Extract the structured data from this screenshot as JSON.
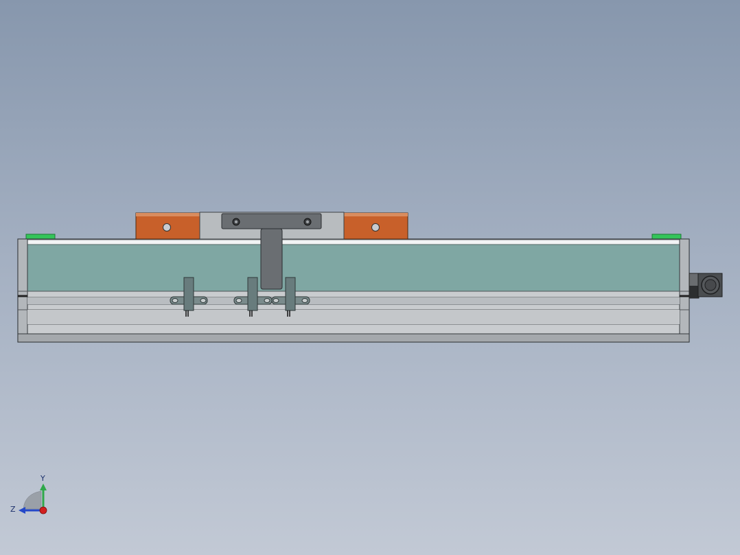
{
  "viewport": {
    "background_top": "#8797ad",
    "background_bottom": "#c2c9d5"
  },
  "model": {
    "colors": {
      "housing_aluminum": "#c9cccf",
      "housing_edge": "#8d9297",
      "cover_strip": "#7fa7a3",
      "carriage_block": "#c8602a",
      "carriage_center": "#b8bcbf",
      "bracket": "#6a6e72",
      "end_stop": "#34c45a",
      "motor_coupler": "#4a4d50",
      "sensor": "#687c7d"
    },
    "icons": [
      "linear-module-assembly",
      "carriage-icon",
      "end-stop-icon",
      "sensor-icon",
      "motor-coupler-icon"
    ]
  },
  "triad": {
    "labels": {
      "y": "Y",
      "z": "Z"
    },
    "colors": {
      "y": "#2fa84a",
      "z": "#2448c8",
      "x": "#d11f1f"
    }
  }
}
